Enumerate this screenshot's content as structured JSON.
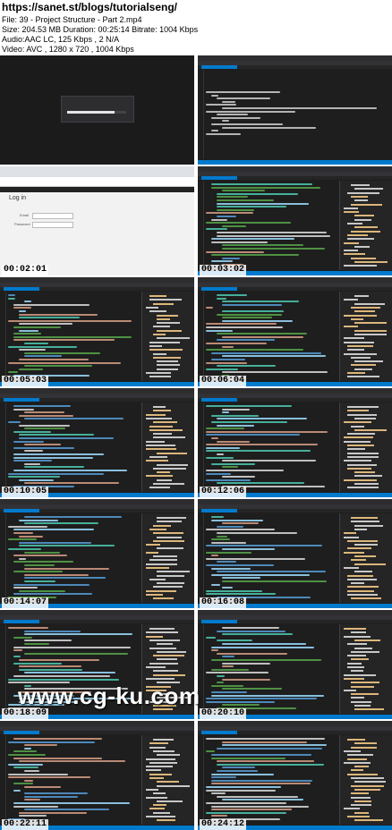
{
  "header": {
    "url": "https://sanet.st/blogs/tutorialseng/",
    "file": "File: 39 - Project Structure - Part 2.mp4",
    "size": "Size: 204.53 MB Duration: 00:25:14 Bitrate: 1004 Kbps",
    "audio": "Audio:AAC LC, 125 Kbps , 2 N/A",
    "video": "Video: AVC , 1280 x 720  , 1004 Kbps"
  },
  "frames": [
    {
      "timestamp": "",
      "kind": "install"
    },
    {
      "timestamp": "",
      "kind": "console"
    },
    {
      "timestamp": "00:02:01",
      "kind": "browser"
    },
    {
      "timestamp": "00:03:02",
      "kind": "code"
    },
    {
      "timestamp": "00:05:03",
      "kind": "code"
    },
    {
      "timestamp": "00:06:04",
      "kind": "code"
    },
    {
      "timestamp": "00:10:05",
      "kind": "code"
    },
    {
      "timestamp": "00:12:06",
      "kind": "code"
    },
    {
      "timestamp": "00:14:07",
      "kind": "code"
    },
    {
      "timestamp": "00:16:08",
      "kind": "code"
    },
    {
      "timestamp": "00:18:09",
      "kind": "code"
    },
    {
      "timestamp": "00:20:10",
      "kind": "code"
    },
    {
      "timestamp": "00:22:11",
      "kind": "code"
    },
    {
      "timestamp": "00:24:12",
      "kind": "code"
    }
  ],
  "browser": {
    "heading": "Log in",
    "email_label": "Email",
    "password_label": "Password"
  },
  "watermark": "www.cg-ku.com",
  "colors": {
    "vs_dark": "#1e1e1e",
    "vs_accent": "#007acc",
    "keyword": "#569cd6",
    "string": "#d69d85",
    "comment": "#57a64a",
    "type": "#4ec9b0"
  }
}
